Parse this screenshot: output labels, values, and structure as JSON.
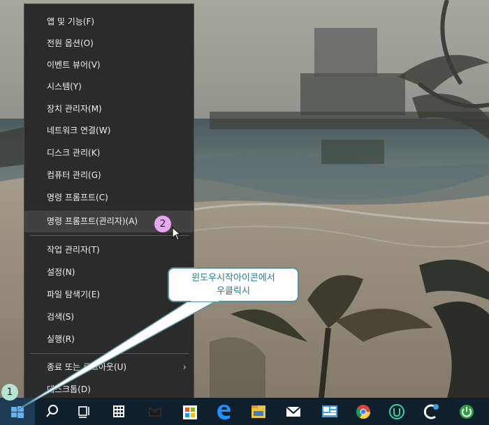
{
  "menu": {
    "items": [
      {
        "label": "앱 및 기능(F)"
      },
      {
        "label": "전원 옵션(O)"
      },
      {
        "label": "이벤트 뷰어(V)"
      },
      {
        "label": "시스템(Y)"
      },
      {
        "label": "장치 관리자(M)"
      },
      {
        "label": "네트워크 연결(W)"
      },
      {
        "label": "디스크 관리(K)"
      },
      {
        "label": "컴퓨터 관리(G)"
      },
      {
        "label": "명령 프롬프트(C)"
      },
      {
        "label": "명령 프롬프트(관리자)(A)"
      },
      {
        "label": "작업 관리자(T)"
      },
      {
        "label": "설정(N)"
      },
      {
        "label": "파일 탐색기(E)"
      },
      {
        "label": "검색(S)"
      },
      {
        "label": "실행(R)"
      },
      {
        "label": "종료 또는 로그아웃(U)"
      },
      {
        "label": "데스크톱(D)"
      }
    ],
    "highlighted_index": 9
  },
  "callout": {
    "line1": "윈도우시작아이콘에서",
    "line2": "우클릭시"
  },
  "badges": {
    "first": "1",
    "second": "2"
  },
  "taskbar": {
    "icons": [
      "windows-start-icon",
      "search-icon",
      "task-view-icon",
      "calculator-icon",
      "photo-editor-icon",
      "store-icon",
      "edge-icon",
      "file-explorer-icon",
      "mail-icon",
      "network-icon",
      "chrome-icon",
      "uplay-icon",
      "ccleaner-icon",
      "power-icon"
    ]
  },
  "colors": {
    "menu_bg": "#2b2b2b",
    "menu_highlight": "#414141",
    "taskbar_bg": "#0f1f2c",
    "callout_text": "#1f7d8f",
    "badge_one": "#b8e4d8",
    "badge_two": "#e8a8f0"
  }
}
